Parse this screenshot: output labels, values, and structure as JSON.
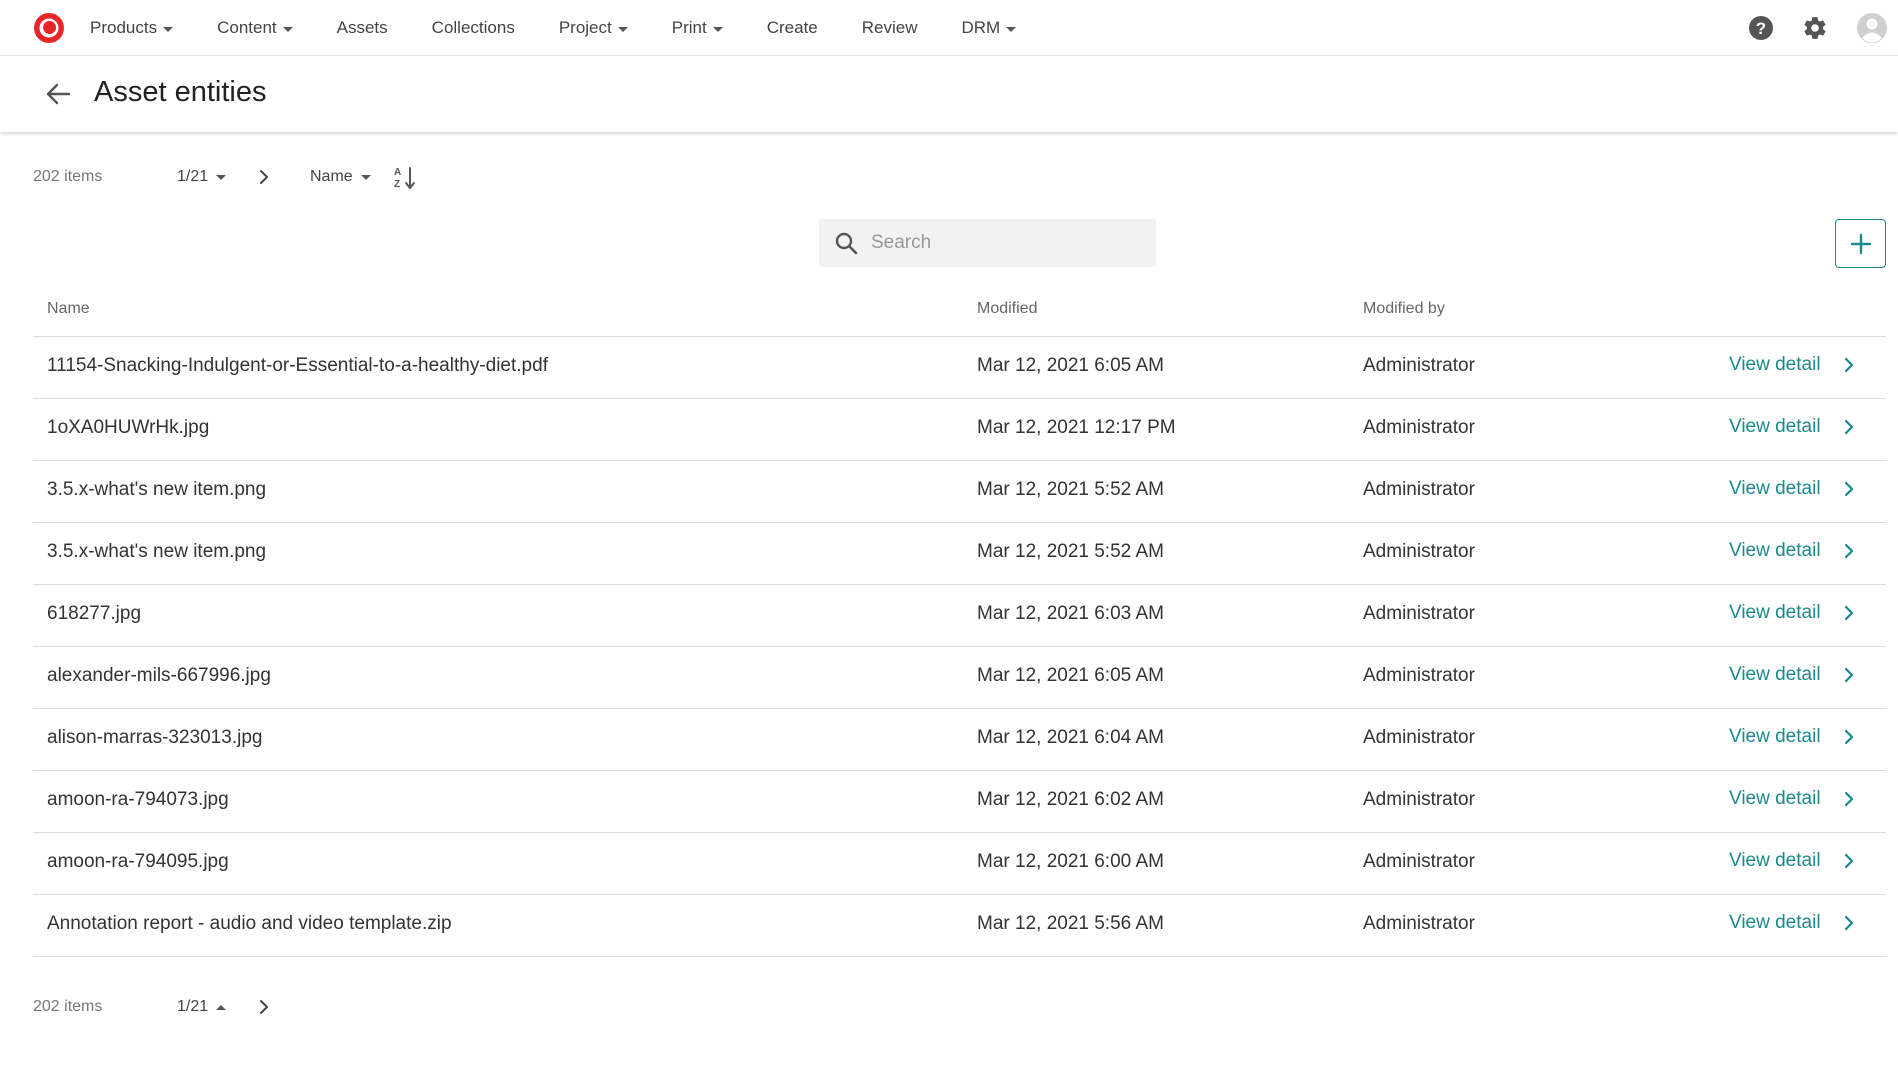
{
  "nav": {
    "items": [
      {
        "label": "Products",
        "dropdown": true
      },
      {
        "label": "Content",
        "dropdown": true
      },
      {
        "label": "Assets",
        "dropdown": false
      },
      {
        "label": "Collections",
        "dropdown": false
      },
      {
        "label": "Project",
        "dropdown": true
      },
      {
        "label": "Print",
        "dropdown": true
      },
      {
        "label": "Create",
        "dropdown": false
      },
      {
        "label": "Review",
        "dropdown": false
      },
      {
        "label": "DRM",
        "dropdown": true
      }
    ],
    "icons": [
      "help-icon",
      "settings-gear-icon",
      "user-avatar-icon"
    ]
  },
  "header": {
    "title": "Asset entities"
  },
  "toolbar": {
    "count": "202 items",
    "page": "1/21",
    "sort_field": "Name"
  },
  "search": {
    "placeholder": "Search"
  },
  "table": {
    "columns": {
      "name": "Name",
      "modified": "Modified",
      "modified_by": "Modified by"
    },
    "detail_label": "View detail",
    "rows": [
      {
        "name": "11154-Snacking-Indulgent-or-Essential-to-a-healthy-diet.pdf",
        "modified": "Mar 12, 2021 6:05 AM",
        "modified_by": "Administrator"
      },
      {
        "name": "1oXA0HUWrHk.jpg",
        "modified": "Mar 12, 2021 12:17 PM",
        "modified_by": "Administrator"
      },
      {
        "name": "3.5.x-what's new item.png",
        "modified": "Mar 12, 2021 5:52 AM",
        "modified_by": "Administrator"
      },
      {
        "name": "3.5.x-what's new item.png",
        "modified": "Mar 12, 2021 5:52 AM",
        "modified_by": "Administrator"
      },
      {
        "name": "618277.jpg",
        "modified": "Mar 12, 2021 6:03 AM",
        "modified_by": "Administrator"
      },
      {
        "name": "alexander-mils-667996.jpg",
        "modified": "Mar 12, 2021 6:05 AM",
        "modified_by": "Administrator"
      },
      {
        "name": "alison-marras-323013.jpg",
        "modified": "Mar 12, 2021 6:04 AM",
        "modified_by": "Administrator"
      },
      {
        "name": "amoon-ra-794073.jpg",
        "modified": "Mar 12, 2021 6:02 AM",
        "modified_by": "Administrator"
      },
      {
        "name": "amoon-ra-794095.jpg",
        "modified": "Mar 12, 2021 6:00 AM",
        "modified_by": "Administrator"
      },
      {
        "name": "Annotation report - audio and video template.zip",
        "modified": "Mar 12, 2021 5:56 AM",
        "modified_by": "Administrator"
      }
    ]
  },
  "footer": {
    "count": "202 items",
    "page": "1/21"
  },
  "colors": {
    "accent": "#1a8a8c",
    "brand": "#e8262a"
  }
}
